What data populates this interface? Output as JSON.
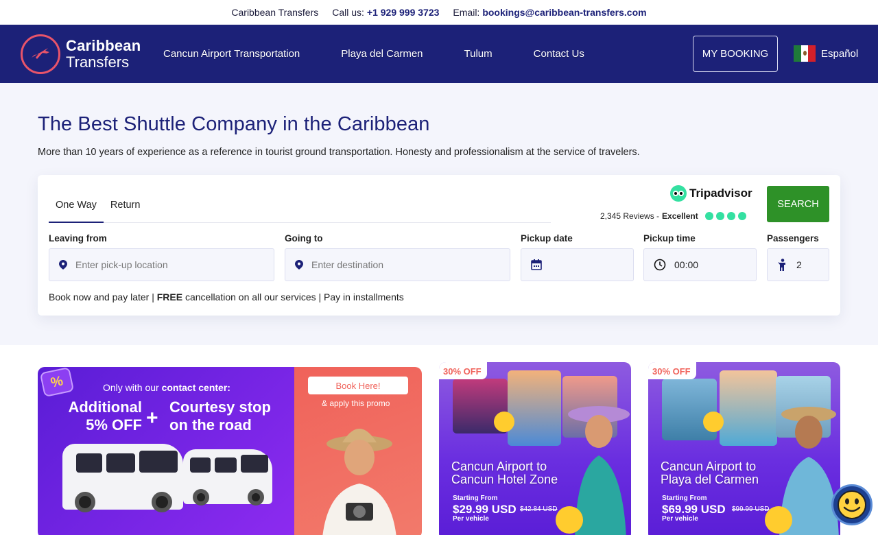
{
  "topbar": {
    "company": "Caribbean Transfers",
    "call_label": "Call us:",
    "phone": "+1 929 999 3723",
    "email_label": "Email:",
    "email": "bookings@caribbean-transfers.com"
  },
  "nav": {
    "logo_line1": "Caribbean",
    "logo_line2": "Transfers",
    "links": [
      "Cancun Airport Transportation",
      "Playa del Carmen",
      "Tulum",
      "Contact Us"
    ],
    "my_booking": "MY BOOKING",
    "language": "Español"
  },
  "hero": {
    "title": "The Best Shuttle Company in the Caribbean",
    "subtitle": "More than 10 years of experience as a reference in tourist ground transportation. Honesty and professionalism at the service of travelers."
  },
  "search": {
    "tabs": [
      "One Way",
      "Return"
    ],
    "active_tab": "One Way",
    "tripadvisor_name": "Tripadvisor",
    "reviews_count": "2,345 Reviews -",
    "reviews_rating": "Excellent",
    "search_button": "SEARCH",
    "leaving_label": "Leaving from",
    "leaving_placeholder": "Enter pick-up location",
    "going_label": "Going to",
    "going_placeholder": "Enter destination",
    "pickup_date_label": "Pickup date",
    "pickup_date_value": "",
    "pickup_time_label": "Pickup time",
    "pickup_time_value": "00:00",
    "passengers_label": "Passengers",
    "passengers_value": "2",
    "note_prefix": "Book now and pay later |",
    "note_free": "FREE",
    "note_suffix": "cancellation on all our services | Pay in installments"
  },
  "promo_main": {
    "badge": "%",
    "contact_prefix": "Only with our",
    "contact_bold": "contact center:",
    "offer_line1": "Additional",
    "offer_line2": "5% OFF",
    "plus": "+",
    "courtesy_line1": "Courtesy stop",
    "courtesy_line2": "on the road",
    "book_here": "Book Here!",
    "apply": "& apply this promo"
  },
  "deals": [
    {
      "discount": "30% OFF",
      "title_line1": "Cancun Airport to",
      "title_line2": "Cancun Hotel Zone",
      "starting_from": "Starting From",
      "price": "$29.99 USD",
      "old_price": "$42.84 USD",
      "per": "Per vehicle"
    },
    {
      "discount": "30% OFF",
      "title_line1": "Cancun Airport to",
      "title_line2": "Playa del Carmen",
      "starting_from": "Starting From",
      "price": "$69.99 USD",
      "old_price": "$99.99 USD",
      "per": "Per vehicle"
    }
  ],
  "colors": {
    "brand_navy": "#1c2178",
    "accent_coral": "#e8546a",
    "search_green": "#2e9128",
    "tripadvisor_green": "#34e0a1",
    "promo_purple": "#5a1dd6"
  },
  "icons": {
    "location": "location-pin-icon",
    "calendar": "calendar-icon",
    "clock": "clock-icon",
    "passenger": "person-icon",
    "chat": "smiley-chat-icon",
    "flag": "mexico-flag-icon"
  }
}
